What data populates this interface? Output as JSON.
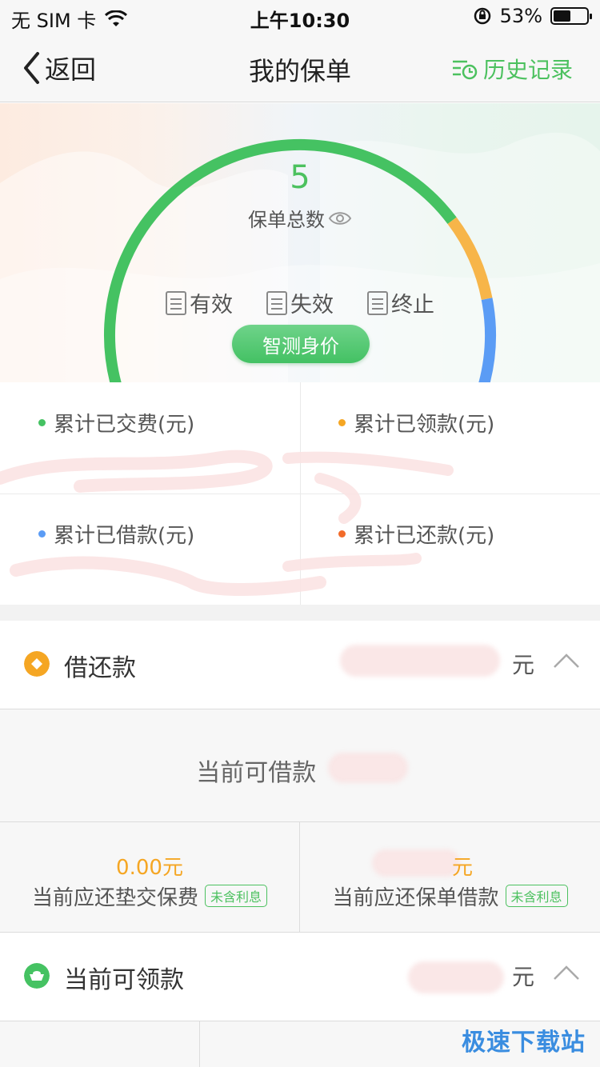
{
  "status_bar": {
    "carrier": "无 SIM 卡",
    "time": "上午10:30",
    "battery_pct": "53%",
    "battery_level": 0.53
  },
  "nav": {
    "back_label": "返回",
    "title": "我的保单",
    "history_label": "历史记录"
  },
  "hero": {
    "count": "5",
    "count_label": "保单总数",
    "legend": [
      {
        "label": "有效"
      },
      {
        "label": "失效"
      },
      {
        "label": "终止"
      }
    ],
    "button_label": "智测身价",
    "colors": {
      "green": "#45c262",
      "orange": "#f7b549",
      "blue": "#5b9cf5"
    }
  },
  "stats": [
    {
      "label": "累计已交费(元)",
      "color": "#45c262"
    },
    {
      "label": "累计已领款(元)",
      "color": "#f5a623"
    },
    {
      "label": "累计已借款(元)",
      "color": "#5b9cf5"
    },
    {
      "label": "累计已还款(元)",
      "color": "#f26b2a"
    }
  ],
  "loan": {
    "title": "借还款",
    "unit": "元",
    "available_label": "当前可借款",
    "advance_amount": "0.00元",
    "advance_label": "当前应还垫交保费",
    "advance_tag": "未含利息",
    "loan_amount_unit": "元",
    "loan_label": "当前应还保单借款",
    "loan_tag": "未含利息"
  },
  "withdraw": {
    "title": "当前可领款",
    "unit": "元"
  },
  "watermark": "极速下载站"
}
